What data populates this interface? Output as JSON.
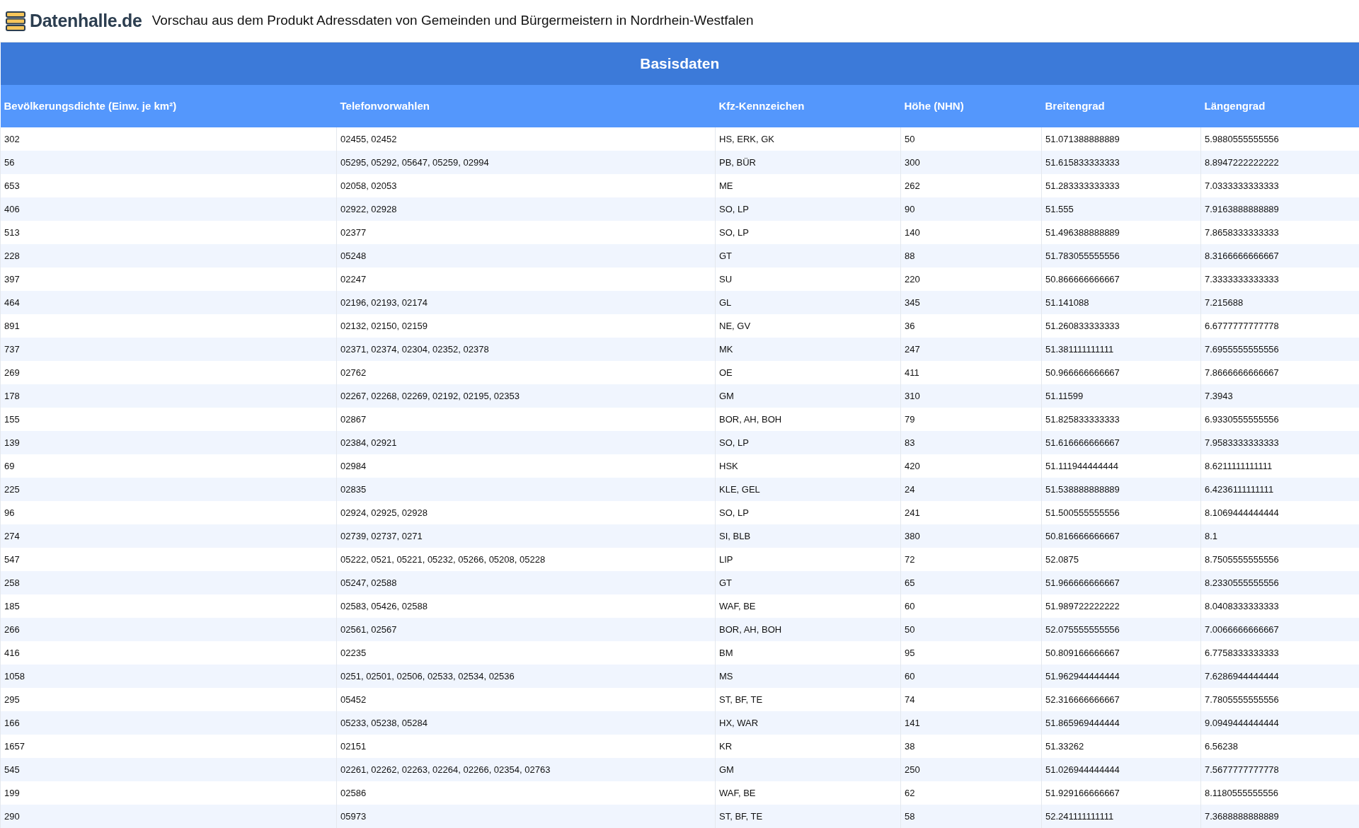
{
  "header": {
    "logo_text": "Datenhalle.de",
    "title": "Vorschau aus dem Produkt Adressdaten von Gemeinden und Bürgermeistern in Nordrhein-Westfalen"
  },
  "table": {
    "caption": "Basisdaten",
    "columns": [
      "Bevölkerungsdichte (Einw. je km²)",
      "Telefonvorwahlen",
      "Kfz-Kennzeichen",
      "Höhe (NHN)",
      "Breitengrad",
      "Längengrad"
    ],
    "rows": [
      [
        "302",
        "02455, 02452",
        "HS, ERK, GK",
        "50",
        "51.071388888889",
        "5.9880555555556"
      ],
      [
        "56",
        "05295, 05292, 05647, 05259, 02994",
        "PB, BÜR",
        "300",
        "51.615833333333",
        "8.8947222222222"
      ],
      [
        "653",
        "02058, 02053",
        "ME",
        "262",
        "51.283333333333",
        "7.0333333333333"
      ],
      [
        "406",
        "02922, 02928",
        "SO, LP",
        "90",
        "51.555",
        "7.9163888888889"
      ],
      [
        "513",
        "02377",
        "SO, LP",
        "140",
        "51.496388888889",
        "7.8658333333333"
      ],
      [
        "228",
        "05248",
        "GT",
        "88",
        "51.783055555556",
        "8.3166666666667"
      ],
      [
        "397",
        "02247",
        "SU",
        "220",
        "50.866666666667",
        "7.3333333333333"
      ],
      [
        "464",
        "02196, 02193, 02174",
        "GL",
        "345",
        "51.141088",
        "7.215688"
      ],
      [
        "891",
        "02132, 02150, 02159",
        "NE, GV",
        "36",
        "51.260833333333",
        "6.6777777777778"
      ],
      [
        "737",
        "02371, 02374, 02304, 02352, 02378",
        "MK",
        "247",
        "51.381111111111",
        "7.6955555555556"
      ],
      [
        "269",
        "02762",
        "OE",
        "411",
        "50.966666666667",
        "7.8666666666667"
      ],
      [
        "178",
        "02267, 02268, 02269, 02192, 02195, 02353",
        "GM",
        "310",
        "51.11599",
        "7.3943"
      ],
      [
        "155",
        "02867",
        "BOR, AH, BOH",
        "79",
        "51.825833333333",
        "6.9330555555556"
      ],
      [
        "139",
        "02384, 02921",
        "SO, LP",
        "83",
        "51.616666666667",
        "7.9583333333333"
      ],
      [
        "69",
        "02984",
        "HSK",
        "420",
        "51.111944444444",
        "8.6211111111111"
      ],
      [
        "225",
        "02835",
        "KLE, GEL",
        "24",
        "51.538888888889",
        "6.4236111111111"
      ],
      [
        "96",
        "02924, 02925, 02928",
        "SO, LP",
        "241",
        "51.500555555556",
        "8.1069444444444"
      ],
      [
        "274",
        "02739, 02737, 0271",
        "SI, BLB",
        "380",
        "50.816666666667",
        "8.1"
      ],
      [
        "547",
        "05222, 0521, 05221, 05232, 05266, 05208, 05228",
        "LIP",
        "72",
        "52.0875",
        "8.7505555555556"
      ],
      [
        "258",
        "05247, 02588",
        "GT",
        "65",
        "51.966666666667",
        "8.2330555555556"
      ],
      [
        "185",
        "02583, 05426, 02588",
        "WAF, BE",
        "60",
        "51.989722222222",
        "8.0408333333333"
      ],
      [
        "266",
        "02561, 02567",
        "BOR, AH, BOH",
        "50",
        "52.075555555556",
        "7.0066666666667"
      ],
      [
        "416",
        "02235",
        "BM",
        "95",
        "50.809166666667",
        "6.7758333333333"
      ],
      [
        "1058",
        "0251, 02501, 02506, 02533, 02534, 02536",
        "MS",
        "60",
        "51.962944444444",
        "7.6286944444444"
      ],
      [
        "295",
        "05452",
        "ST, BF, TE",
        "74",
        "52.316666666667",
        "7.7805555555556"
      ],
      [
        "166",
        "05233, 05238, 05284",
        "HX, WAR",
        "141",
        "51.865969444444",
        "9.0949444444444"
      ],
      [
        "1657",
        "02151",
        "KR",
        "38",
        "51.33262",
        "6.56238"
      ],
      [
        "545",
        "02261, 02262, 02263, 02264, 02266, 02354, 02763",
        "GM",
        "250",
        "51.026944444444",
        "7.5677777777778"
      ],
      [
        "199",
        "02586",
        "WAF, BE",
        "62",
        "51.929166666667",
        "8.1180555555556"
      ],
      [
        "290",
        "05973",
        "ST, BF, TE",
        "58",
        "52.241111111111",
        "7.3688888888889"
      ]
    ]
  }
}
